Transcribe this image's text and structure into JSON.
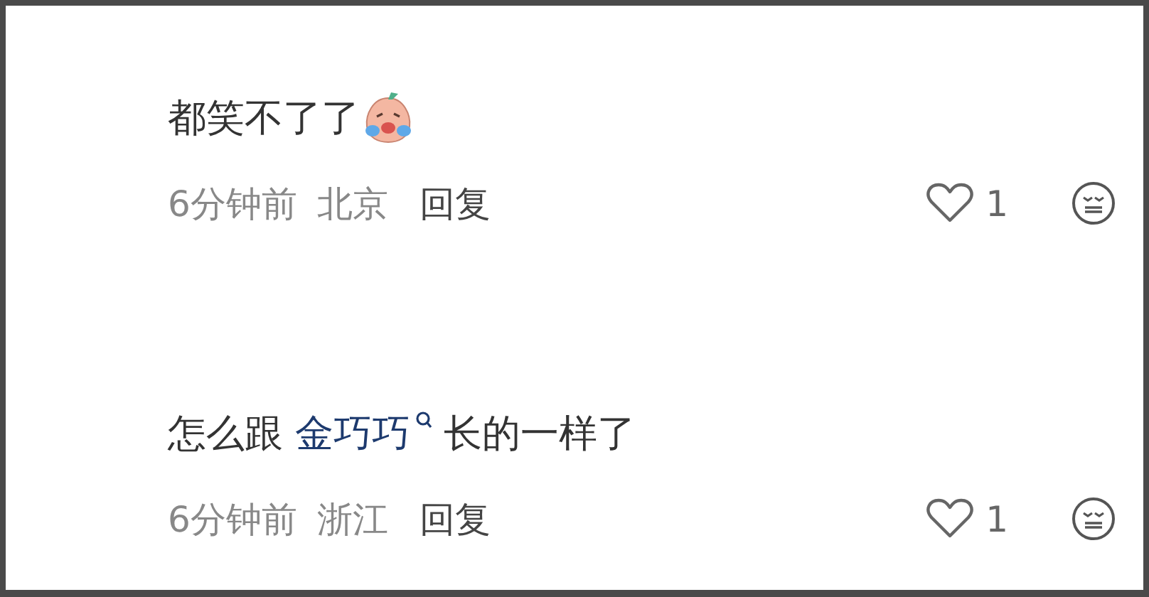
{
  "comments": [
    {
      "content": [
        {
          "kind": "text",
          "text": "都笑不了了"
        },
        {
          "kind": "sticker"
        }
      ],
      "time": "6分钟前",
      "location": "北京",
      "reply": "回复",
      "likes": "1",
      "liked": false
    },
    {
      "content": [
        {
          "kind": "text",
          "text": "怎么跟 "
        },
        {
          "kind": "link",
          "text": "金巧巧"
        },
        {
          "kind": "text",
          "text": " 长的一样了"
        }
      ],
      "time": "6分钟前",
      "location": "浙江",
      "reply": "回复",
      "likes": "1",
      "liked": false
    }
  ]
}
